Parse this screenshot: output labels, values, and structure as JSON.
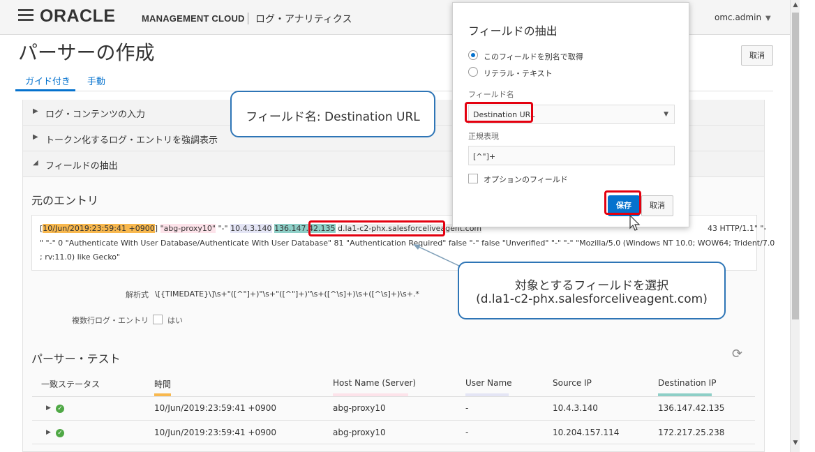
{
  "header": {
    "logo": "ORACLE",
    "product": "MANAGEMENT CLOUD",
    "app_name": "ログ・アナリティクス",
    "user": "omc.admin"
  },
  "page": {
    "title": "パーサーの作成",
    "tabs": [
      "ガイド付き",
      "手動"
    ],
    "cancel_label": "取消"
  },
  "accordion": [
    {
      "label": "ログ・コンテンツの入力",
      "expanded": false
    },
    {
      "label": "トークン化するログ・エントリを強調表示",
      "expanded": false
    },
    {
      "label": "フィールドの抽出",
      "expanded": true
    }
  ],
  "entry": {
    "section_title": "元のエントリ",
    "open_bracket": "[",
    "timestamp": "10/Jun/2019:23:59:41 +0900",
    "after_ts": "] ",
    "host": "\"abg-proxy10\"",
    "dash1": " \"-\" ",
    "src_ip": "10.4.3.140",
    "dst_ip": "136.147.42.135",
    "url": "d.la1-c2-phx.salesforceliveagent.com",
    "line1_tail": "43 HTTP/1.1\" \"-",
    "line2": "\" \"-\" 0 \"Authenticate With User Database/Authenticate With User Database\" 81 \"Authentication Required\" false \"-\" false \"Unverified\" \"-\" \"-\" \"Mozilla/5.0 (Windows NT 10.0; WOW64; Trident/7.0",
    "line3": "; rv:11.0) like Gecko\""
  },
  "parse": {
    "expr_label": "解析式",
    "expr": "\\[{TIMEDATE}\\]\\s+\"([^\"]+)\"\\s+\"([^\"]+)\"\\s+([^\\s]+)\\s+([^\\s]+)\\s+.*",
    "multiline_label": "複数行ログ・エントリ",
    "multiline_option": "はい"
  },
  "test": {
    "section_title": "パーサー・テスト",
    "columns": [
      "一致ステータス",
      "時間",
      "Host Name (Server)",
      "User Name",
      "Source IP",
      "Destination IP"
    ],
    "rows": [
      {
        "time": "10/Jun/2019:23:59:41 +0900",
        "host": "abg-proxy10",
        "user": "-",
        "src": "10.4.3.140",
        "dst": "136.147.42.135"
      },
      {
        "time": "10/Jun/2019:23:59:41 +0900",
        "host": "abg-proxy10",
        "user": "-",
        "src": "10.204.157.114",
        "dst": "172.217.25.238"
      }
    ]
  },
  "dialog": {
    "title": "フィールドの抽出",
    "radio_alias": "このフィールドを別名で取得",
    "radio_literal": "リテラル・テキスト",
    "field_name_label": "フィールド名",
    "field_name_value": "Destination URL",
    "regex_label": "正規表現",
    "regex_value": "[^\"]+",
    "optional_label": "オプションのフィールド",
    "save_label": "保存",
    "cancel_label": "取消"
  },
  "callouts": {
    "field_name": "フィールド名: Destination URL",
    "select_line1": "対象とするフィールドを選択",
    "select_line2": "(d.la1-c2-phx.salesforceliveagent.com)"
  },
  "icons": {
    "menu": "hamburger-icon",
    "refresh": "refresh-icon",
    "ok": "check-circle-icon"
  },
  "colors": {
    "accent": "#0572ce",
    "highlight_red": "#e3000f",
    "callout_border": "#2e75b6",
    "time_color": "#f8b84e",
    "host_color": "#fde3ea",
    "user_color": "#e4e5f5",
    "dst_color": "#8ecfc7"
  }
}
